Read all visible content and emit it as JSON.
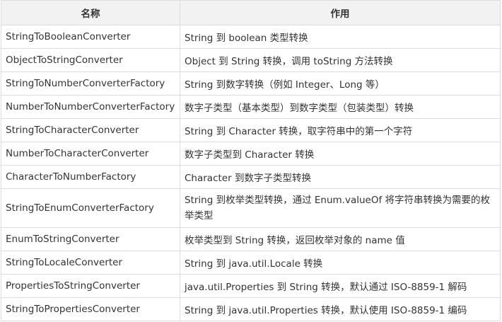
{
  "table": {
    "headers": [
      "名称",
      "作用"
    ],
    "rows": [
      {
        "name": "StringToBooleanConverter",
        "desc": "String 到 boolean 类型转换"
      },
      {
        "name": "ObjectToStringConverter",
        "desc": "Object 到 String 转换，调用 toString 方法转换"
      },
      {
        "name": "StringToNumberConverterFactory",
        "desc": "String 到数字转换（例如 Integer、Long 等）"
      },
      {
        "name": "NumberToNumberConverterFactory",
        "desc": "数字子类型（基本类型）到数字类型（包装类型）转换"
      },
      {
        "name": "StringToCharacterConverter",
        "desc": "String 到 Character 转换，取字符串中的第一个字符"
      },
      {
        "name": "NumberToCharacterConverter",
        "desc": "数字子类型到 Character 转换"
      },
      {
        "name": "CharacterToNumberFactory",
        "desc": "Character 到数字子类型转换"
      },
      {
        "name": "StringToEnumConverterFactory",
        "desc": "String 到枚举类型转换，通过 Enum.valueOf 将字符串转换为需要的枚举类型"
      },
      {
        "name": "EnumToStringConverter",
        "desc": "枚举类型到 String 转换，返回枚举对象的 name 值"
      },
      {
        "name": "StringToLocaleConverter",
        "desc": "String 到 java.util.Locale 转换"
      },
      {
        "name": "PropertiesToStringConverter",
        "desc": "java.util.Properties 到 String 转换，默认通过 ISO-8859-1 解码"
      },
      {
        "name": "StringToPropertiesConverter",
        "desc": "String 到 java.util.Properties 转换，默认使用 ISO-8859-1 编码"
      }
    ]
  }
}
